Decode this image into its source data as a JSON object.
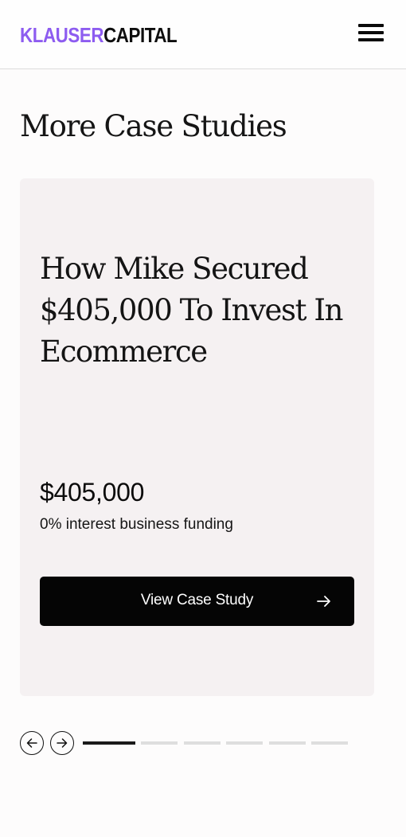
{
  "header": {
    "logo_part1": "KLAUSER",
    "logo_part2": "CAPITAL",
    "menu_icon": "hamburger-menu-icon"
  },
  "section": {
    "title": "More Case Studies"
  },
  "card": {
    "title": "How Mike Secured $405,000 To Invest In Ecommerce",
    "amount": "$405,000",
    "amount_description": "0% interest business funding",
    "cta_label": "View Case Study",
    "cta_icon": "arrow-right-icon"
  },
  "carousel": {
    "prev_icon": "arrow-left-circle-icon",
    "next_icon": "arrow-right-circle-icon",
    "slide_count": 6,
    "active_index": 0
  },
  "colors": {
    "brand_accent": "#8d5cf0",
    "card_background": "#f5f1f2",
    "button_background": "#050505",
    "indicator_active": "#1a1a1a",
    "indicator_inactive": "#dedede"
  }
}
